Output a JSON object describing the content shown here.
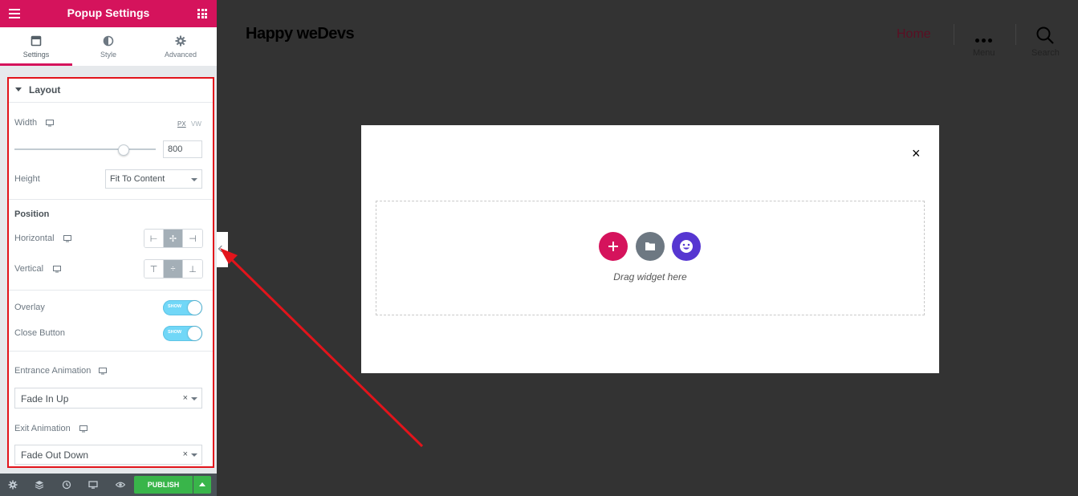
{
  "sidebar": {
    "header": {
      "title": "Popup Settings"
    },
    "tabs": [
      {
        "label": "Settings",
        "icon": "settings-window-icon",
        "active": true
      },
      {
        "label": "Style",
        "icon": "half-circle-icon",
        "active": false
      },
      {
        "label": "Advanced",
        "icon": "gear-icon",
        "active": false
      }
    ],
    "layout_section": {
      "title": "Layout",
      "width": {
        "label": "Width",
        "units": [
          "PX",
          "VW"
        ],
        "selected_unit": "PX",
        "value": "800"
      },
      "height": {
        "label": "Height",
        "value": "Fit To Content"
      },
      "position": {
        "title": "Position",
        "horizontal_label": "Horizontal",
        "vertical_label": "Vertical",
        "horizontal_selected": "center",
        "vertical_selected": "middle"
      },
      "overlay": {
        "label": "Overlay",
        "toggle_text": "SHOW",
        "on": true
      },
      "close_button": {
        "label": "Close Button",
        "toggle_text": "SHOW",
        "on": true
      },
      "entrance_animation": {
        "label": "Entrance Animation",
        "value": "Fade In Up"
      },
      "exit_animation": {
        "label": "Exit Animation",
        "value": "Fade Out Down"
      }
    },
    "footer": {
      "publish_label": "PUBLISH"
    }
  },
  "site": {
    "title": "Happy weDevs",
    "nav": {
      "home": "Home",
      "menu_label": "Menu",
      "search_label": "Search"
    }
  },
  "popup": {
    "close_symbol": "×",
    "drop_text": "Drag widget here"
  },
  "colors": {
    "brand": "#d5135c",
    "publish": "#39b54a",
    "toggle": "#71d7f7",
    "highlight_border": "#e2141b",
    "canvas_bg": "#333333"
  }
}
